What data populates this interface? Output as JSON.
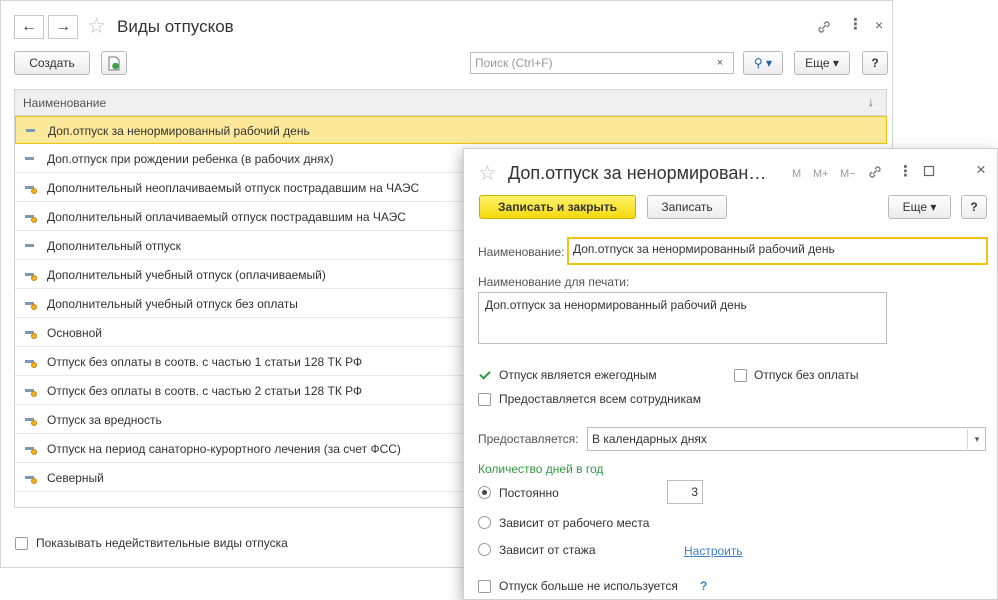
{
  "list_window": {
    "title": "Виды отпусков",
    "nav": {
      "back_glyph": "←",
      "forward_glyph": "→"
    },
    "toolbar": {
      "create_label": "Создать",
      "search_placeholder": "Поиск (Ctrl+F)",
      "search_clear_glyph": "×",
      "search_button_glyph": "⚲ ▾",
      "more_label": "Еще ▾",
      "help_label": "?"
    },
    "table": {
      "column_header": "Наименование",
      "sort_glyph": "↓",
      "rows": [
        {
          "label": "Доп.отпуск за ненормированный рабочий день",
          "icon": "item-icon",
          "selected": true
        },
        {
          "label": "Доп.отпуск при рождении ребенка (в рабочих днях)",
          "icon": "item-icon"
        },
        {
          "label": "Дополнительный неоплачиваемый отпуск пострадавшим на ЧАЭС",
          "icon": "predefined-item-icon"
        },
        {
          "label": "Дополнительный оплачиваемый отпуск пострадавшим на ЧАЭС",
          "icon": "predefined-item-icon"
        },
        {
          "label": "Дополнительный отпуск",
          "icon": "item-icon"
        },
        {
          "label": "Дополнительный учебный отпуск (оплачиваемый)",
          "icon": "predefined-item-icon"
        },
        {
          "label": "Дополнительный учебный отпуск без оплаты",
          "icon": "predefined-item-icon"
        },
        {
          "label": "Основной",
          "icon": "predefined-item-icon"
        },
        {
          "label": "Отпуск без оплаты в соотв. с частью 1 статьи 128 ТК РФ",
          "icon": "predefined-item-icon"
        },
        {
          "label": "Отпуск без оплаты в соотв. с частью 2 статьи 128 ТК РФ",
          "icon": "predefined-item-icon"
        },
        {
          "label": "Отпуск за вредность",
          "icon": "predefined-item-icon"
        },
        {
          "label": "Отпуск на период санаторно-курортного лечения (за счет ФСС)",
          "icon": "predefined-item-icon"
        },
        {
          "label": "Северный",
          "icon": "predefined-item-icon"
        }
      ]
    },
    "footer": {
      "show_invalid_label": "Показывать недействительные виды отпуска"
    }
  },
  "detail_window": {
    "title": "Доп.отпуск за ненормирован…",
    "header_buttons": {
      "m": "M",
      "m_plus": "M+",
      "m_minus": "M−"
    },
    "toolbar": {
      "save_close_label": "Записать и закрыть",
      "save_label": "Записать",
      "more_label": "Еще ▾",
      "help_label": "?"
    },
    "name_label": "Наименование:",
    "name_value": "Доп.отпуск за ненормированный рабочий день",
    "print_name_label": "Наименование для печати:",
    "print_name_value": "Доп.отпуск за ненормированный рабочий день",
    "annual_label": "Отпуск является ежегодным",
    "annual_checked": true,
    "unpaid_label": "Отпуск без оплаты",
    "all_employees_label": "Предоставляется всем сотрудникам",
    "provided_label": "Предоставляется:",
    "provided_value": "В календарных днях",
    "days_section_title": "Количество дней в год",
    "radio_constant_label": "Постоянно",
    "days_value": "3",
    "radio_workplace_label": "Зависит от рабочего места",
    "radio_seniority_label": "Зависит от стажа",
    "configure_link": "Настроить",
    "not_used_label": "Отпуск больше не используется",
    "help_mark": "?"
  },
  "colors": {
    "accent_yellow": "#f5d90d",
    "selection": "#fce999",
    "section_green": "#2e9a3f",
    "link_blue": "#3d7fc4"
  }
}
